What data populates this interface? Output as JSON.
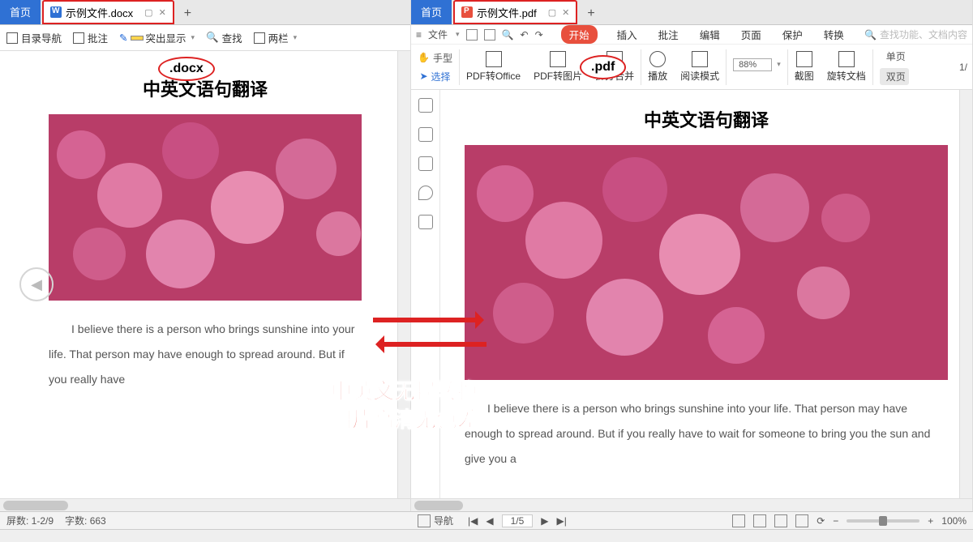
{
  "left": {
    "home": "首页",
    "tabTitle": "示例文件.docx",
    "extAnno": ".docx",
    "toolbar": {
      "nav": "目录导航",
      "annotate": "批注",
      "highlight": "突出显示",
      "find": "查找",
      "twoCol": "两栏"
    },
    "doc": {
      "title": "中英文语句翻译",
      "body": "I believe there is a person who brings sunshine into your life. That person may have enough to spread around. But if you really have"
    },
    "status": {
      "pages": "屏数: 1-2/9",
      "words": "字数: 663"
    }
  },
  "right": {
    "home": "首页",
    "tabTitle": "示例文件.pdf",
    "extAnno": ".pdf",
    "smallbar": {
      "file": "文件"
    },
    "menutabs": {
      "start": "开始",
      "insert": "插入",
      "annotate": "批注",
      "edit": "编辑",
      "page": "页面",
      "protect": "保护",
      "convert": "转换"
    },
    "searchHint": "查找功能、文档内容",
    "ribbon": {
      "hand": "手型",
      "select": "选择",
      "pdf2office": "PDF转Office",
      "pdf2img": "PDF转图片",
      "splitmerge": "拆分合并",
      "play": "播放",
      "readmode": "阅读模式",
      "zoom": "88%",
      "fit1": "",
      "crop": "截图",
      "rotate": "旋转文档",
      "singlePage": "单页",
      "doublePage": "双页"
    },
    "doc": {
      "title": "中英文语句翻译",
      "body": "I believe there is a person who brings sunshine into your life. That person may have enough to spread around. But if you really have to wait for someone to bring you the sun and give you a"
    },
    "status": {
      "nav": "导航",
      "page": "1/5",
      "zoom": "100%",
      "pageInd": "1/5"
    },
    "pageIndicator": "1/"
  },
  "overlay": {
    "line1": "中英文无损转换",
    "line2": "图片高清无色差"
  }
}
